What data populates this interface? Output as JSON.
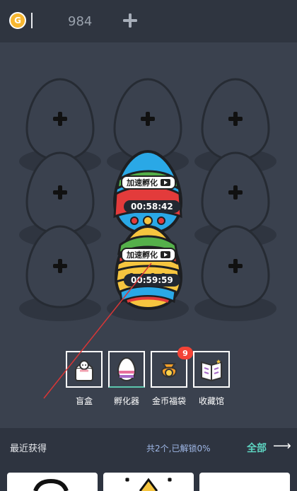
{
  "top": {
    "coin_symbol": "G",
    "coin_amount": "984",
    "plus_icon": "plus-icon"
  },
  "incubator": {
    "egg_slots": 9,
    "active_eggs": [
      {
        "accelerate": "加速孵化",
        "timer": "00:58:42"
      },
      {
        "accelerate": "加速孵化",
        "timer": "00:59:59"
      }
    ]
  },
  "tools": [
    {
      "label": "盲盒",
      "icon": "blind-box-icon"
    },
    {
      "label": "孵化器",
      "icon": "incubator-egg-icon"
    },
    {
      "label": "金币福袋",
      "icon": "coin-bag-icon",
      "badge": "9"
    },
    {
      "label": "收藏馆",
      "icon": "collection-book-icon"
    }
  ],
  "bottom": {
    "title": "最近获得",
    "count": "共2个,已解锁0%",
    "all": "全部",
    "arrow": "⟶"
  },
  "colors": {
    "bg": "#3a414e",
    "topbar": "#2f3540",
    "accent": "#5dd3c0",
    "badge": "#f44336"
  }
}
